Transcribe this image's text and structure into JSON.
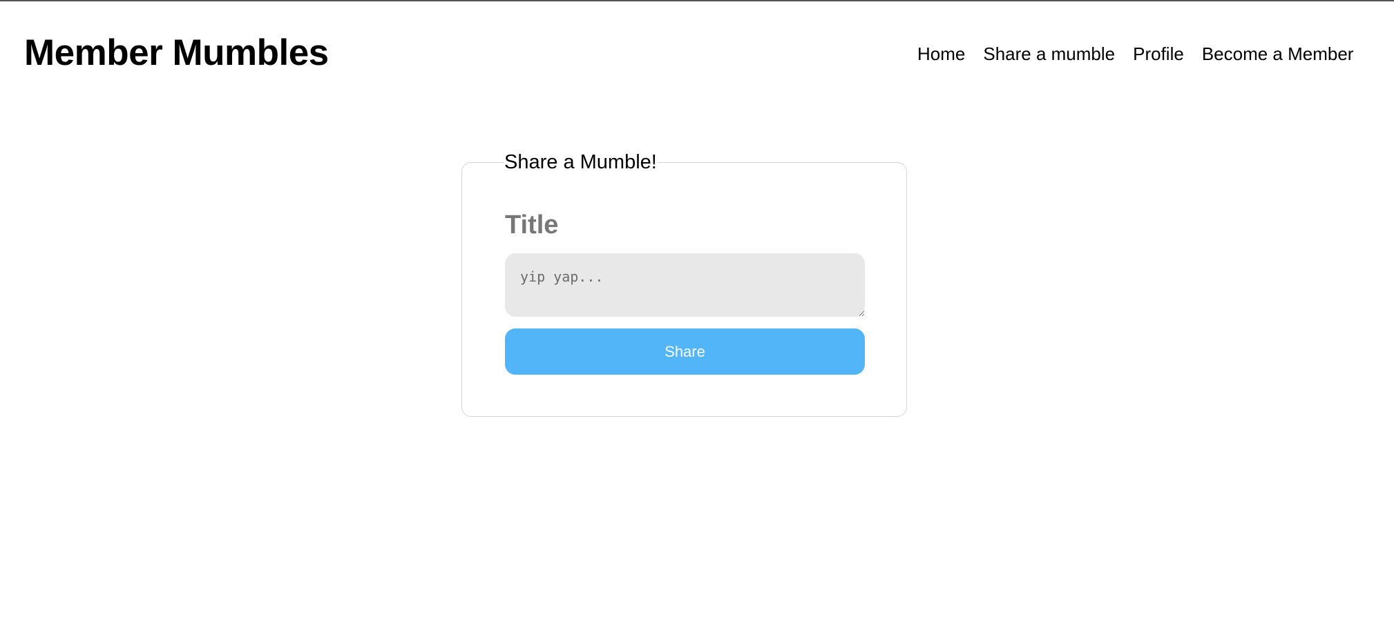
{
  "header": {
    "brand": "Member Mumbles",
    "nav": [
      "Home",
      "Share a mumble",
      "Profile",
      "Become a Member"
    ]
  },
  "form": {
    "legend": "Share a Mumble!",
    "title_label": "Title",
    "textarea_placeholder": "yip yap...",
    "textarea_value": "",
    "submit_label": "Share"
  },
  "colors": {
    "button": "#52b5f8",
    "textarea_bg": "#e8e8e8",
    "label": "#777777"
  }
}
